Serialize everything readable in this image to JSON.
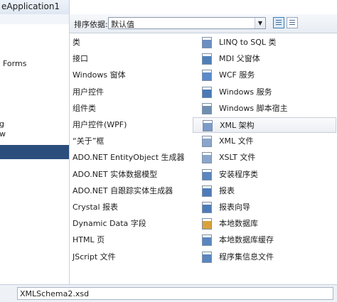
{
  "left_panel": {
    "title": "eApplication1",
    "items": [
      "Forms",
      "g",
      "w"
    ]
  },
  "toolbar": {
    "sort_label": "排序依据:",
    "sort_value": "默认值"
  },
  "templates_left": [
    "类",
    "接口",
    "Windows 窗体",
    "用户控件",
    "组件类",
    "用户控件(WPF)",
    "“关于”框",
    "ADO.NET EntityObject 生成器",
    "ADO.NET 实体数据模型",
    "ADO.NET 自跟踪实体生成器",
    "Crystal 报表",
    "Dynamic Data 字段",
    "HTML 页",
    "JScript 文件"
  ],
  "templates_right": [
    {
      "label": "LINQ to SQL 类",
      "icon": "linq-class-icon",
      "color": "#6b8fc2"
    },
    {
      "label": "MDI 父窗体",
      "icon": "mdi-form-icon",
      "color": "#4f7fb8"
    },
    {
      "label": "WCF 服务",
      "icon": "wcf-service-icon",
      "color": "#5a8acb"
    },
    {
      "label": "Windows 服务",
      "icon": "windows-service-icon",
      "color": "#4a7ab5"
    },
    {
      "label": "Windows 脚本宿主",
      "icon": "script-host-icon",
      "color": "#6f8fb0"
    },
    {
      "label": "XML 架构",
      "icon": "xml-schema-icon",
      "color": "#7a9ac8"
    },
    {
      "label": "XML 文件",
      "icon": "xml-file-icon",
      "color": "#8aa6cc"
    },
    {
      "label": "XSLT 文件",
      "icon": "xslt-file-icon",
      "color": "#8aa6cc"
    },
    {
      "label": "安装程序类",
      "icon": "installer-class-icon",
      "color": "#5b86bf"
    },
    {
      "label": "报表",
      "icon": "report-icon",
      "color": "#4e7cb8"
    },
    {
      "label": "报表向导",
      "icon": "report-wizard-icon",
      "color": "#4e7cb8"
    },
    {
      "label": "本地数据库",
      "icon": "local-database-icon",
      "color": "#d9a13a"
    },
    {
      "label": "本地数据库缓存",
      "icon": "local-db-cache-icon",
      "color": "#5a86be"
    },
    {
      "label": "程序集信息文件",
      "icon": "assembly-info-icon",
      "color": "#5a86be"
    }
  ],
  "selected_template": "XML 架构",
  "name_field": {
    "value": "XMLSchema2.xsd"
  },
  "colors": {
    "selection_bg": "#2b4e7d",
    "toolbar_bg": "#e7ecf3"
  }
}
